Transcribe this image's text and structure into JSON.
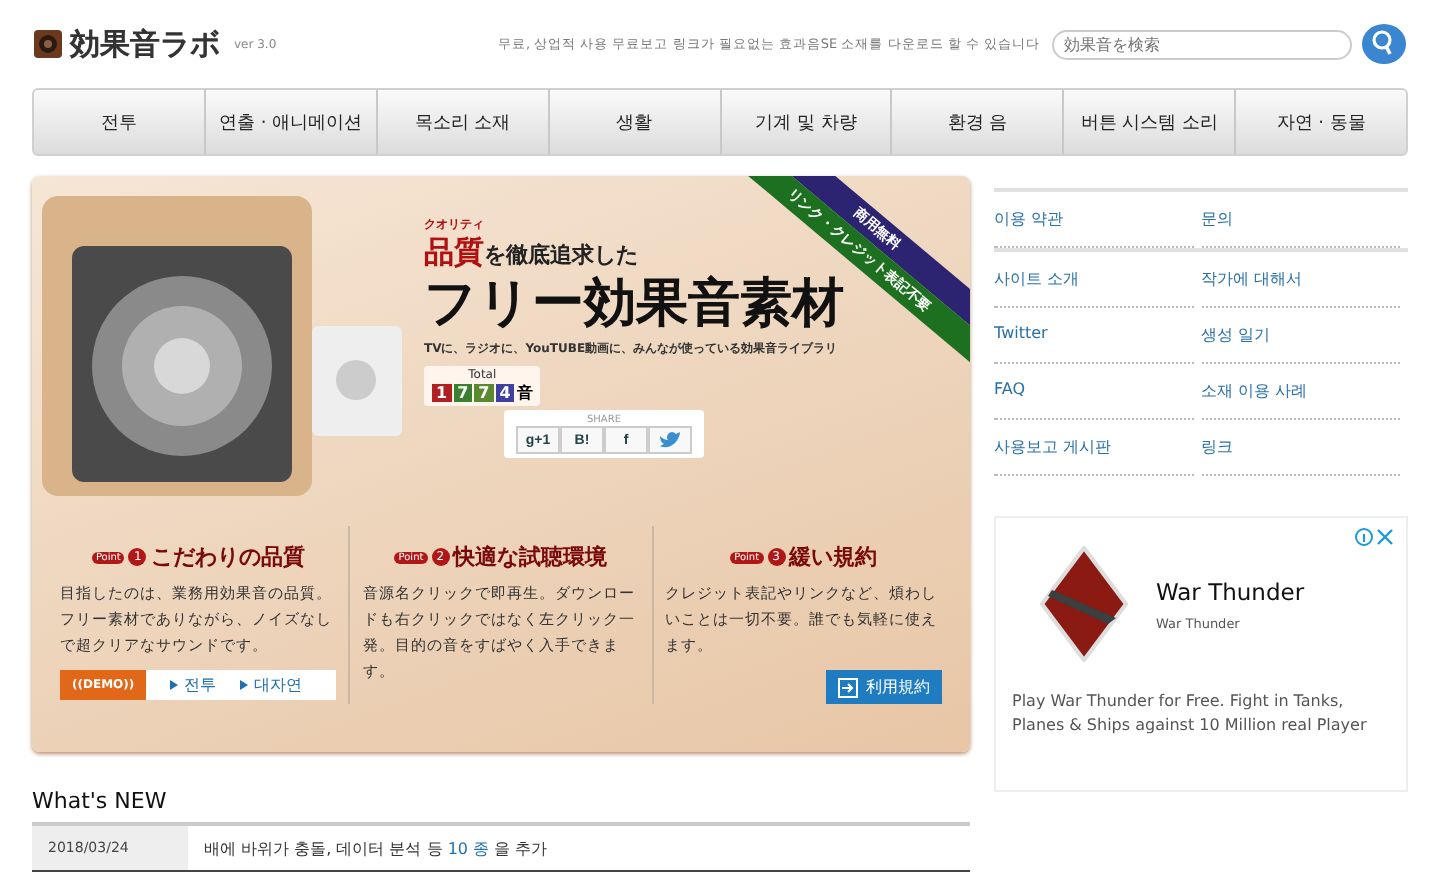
{
  "header": {
    "logo": "効果音ラボ",
    "version": "ver 3.0",
    "tagline": "무료, 상업적 사용 무료보고 링크가 필요없는 효과음SE 소재를 다운로드 할 수 있습니다",
    "search": {
      "placeholder": "効果音を検索"
    }
  },
  "nav": [
    "전투",
    "연출 · 애니메이션",
    "목소리 소재",
    "생활",
    "기계 및 차량",
    "환경 음",
    "버튼 시스템 소리",
    "자연 · 동물"
  ],
  "banner": {
    "ribbons": [
      "商用無料",
      "リンク・クレジット表記不要"
    ],
    "kicker": "クオリティ",
    "headline_accent": "品質",
    "headline_rest": "を徹底追求した",
    "title": "フリー効果音素材",
    "subtitle": "TVに、ラジオに、YouTUBE動画に、みんなが使っている効果音ライブラリ",
    "counter": {
      "label": "Total",
      "digits": [
        "1",
        "7",
        "7",
        "4"
      ],
      "unit": "音"
    },
    "share": {
      "label": "SHARE",
      "buttons": [
        {
          "kind": "text",
          "label": "g+1"
        },
        {
          "kind": "text",
          "label": "B!"
        },
        {
          "kind": "text",
          "label": "f"
        },
        {
          "kind": "twitter"
        }
      ]
    },
    "points": [
      {
        "badge": "Point",
        "number": "1",
        "title": "こだわりの品質",
        "text": "目指したのは、業務用効果音の品質。フリー素材でありながら、ノイズなしで超クリアなサウンドです。"
      },
      {
        "badge": "Point",
        "number": "2",
        "title": "快適な試聴環境",
        "text": "音源名クリックで即再生。ダウンロードも右クリックではなく左クリック一発。目的の音をすばやく入手できます。"
      },
      {
        "badge": "Point",
        "number": "3",
        "title": "緩い規約",
        "text": "クレジット表記やリンクなど、煩わしいことは一切不要。誰でも気軽に使えます。"
      }
    ],
    "demo": {
      "label": "((DEMO))",
      "links": [
        "전투",
        "대자연"
      ]
    },
    "terms_button": "利用規約"
  },
  "sidebar": {
    "links": [
      [
        "이용 약관",
        "문의"
      ],
      [
        "사이트 소개",
        "작가에 대해서"
      ],
      [
        "Twitter",
        "생성 일기"
      ],
      [
        "FAQ",
        "소재 이용 사례"
      ],
      [
        "사용보고 게시판",
        "링크"
      ]
    ]
  },
  "ad": {
    "title": "War Thunder",
    "source": "War Thunder",
    "text": "Play War Thunder for Free. Fight in Tanks, Planes & Ships against 10 Million real Player"
  },
  "news": {
    "heading": "What's NEW",
    "rows": [
      {
        "date": "2018/03/24",
        "before": "배에 바위가 충돌, 데이터 분석 등 ",
        "link": "10 종",
        "after": " 을 추가"
      }
    ]
  }
}
